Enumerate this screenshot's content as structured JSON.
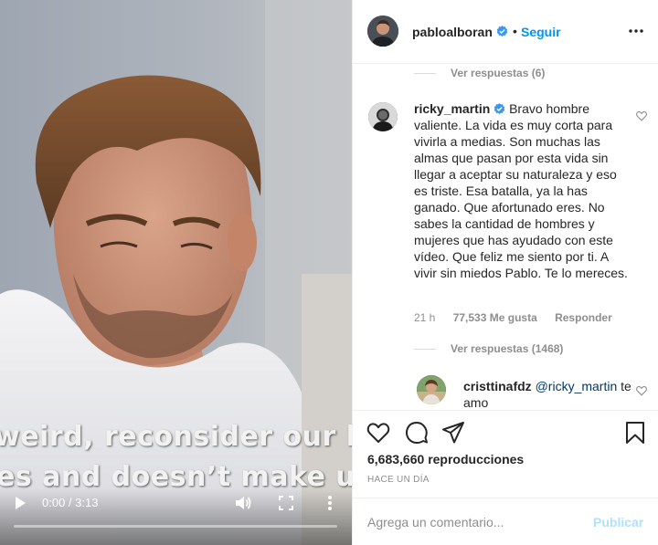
{
  "video": {
    "subtitle_line_1": "weird, reconsider our liv",
    "subtitle_line_2": "es and doesn’t make us",
    "time_display": "0:00 / 3:13",
    "progress": 0.0,
    "icons": {
      "play": "play-icon",
      "volume": "volume-icon",
      "fullscreen": "fullscreen-icon",
      "more": "more-vertical-icon"
    }
  },
  "header": {
    "username": "pabloalboran",
    "separator": "•",
    "follow_label": "Seguir",
    "follow_color": "#0095f6"
  },
  "comments": {
    "view_replies_1": "Ver respuestas (6)",
    "main_comment": {
      "username": "ricky_martin",
      "text": "Bravo hombre valiente. La vida es muy corta para vivirla a medias. Son muchas las almas que pasan por esta vida sin llegar a aceptar su naturaleza y eso es triste. Esa batalla, ya la has ganado. Que afortunado eres. No sabes la cantidad de hombres y mujeres que has ayudado con este vídeo. Que feliz me siento por ti. A vivir sin miedos Pablo. Te lo mereces.",
      "age": "21 h",
      "likes": "77,533 Me gusta",
      "reply_label": "Responder"
    },
    "view_replies_2": "Ver respuestas (1468)",
    "reply": {
      "username": "cristtinafdz",
      "mention": "@ricky_martin",
      "text": "te amo"
    }
  },
  "actions": {
    "views_count": "6,683,660",
    "views_label": "reproducciones",
    "timestamp": "HACE UN DÍA"
  },
  "comment_box": {
    "placeholder": "Agrega un comentario...",
    "post_label": "Publicar",
    "post_color": "#b2dffc"
  }
}
